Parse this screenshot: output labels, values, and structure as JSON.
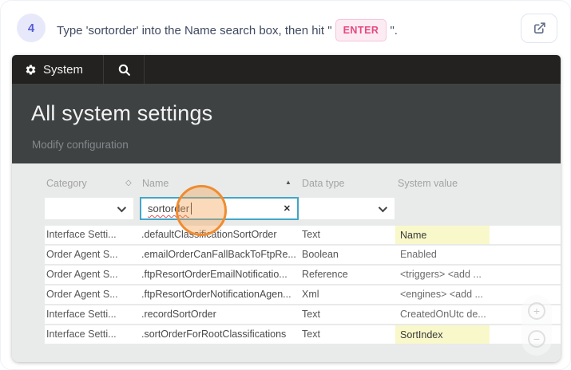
{
  "step": {
    "number": "4",
    "instruction_prefix": "Type 'sortorder' into the Name search box, then hit \"",
    "key_label": "ENTER",
    "instruction_suffix": "\"."
  },
  "app": {
    "navbar": {
      "system_label": "System"
    },
    "header": {
      "title": "All system settings",
      "subtitle": "Modify configuration"
    },
    "table": {
      "headers": {
        "category": "Category",
        "name": "Name",
        "data_type": "Data type",
        "system_value": "System value"
      },
      "filters": {
        "name_value": "sortorder"
      },
      "rows": [
        {
          "category": "Interface Setti...",
          "name": ".defaultClassificationSortOrder",
          "data_type": "Text",
          "system_value": "Name"
        },
        {
          "category": "Order Agent S...",
          "name": ".emailOrderCanFallBackToFtpRe...",
          "data_type": "Boolean",
          "system_value": "Enabled"
        },
        {
          "category": "Order Agent S...",
          "name": ".ftpResortOrderEmailNotificatio...",
          "data_type": "Reference",
          "system_value": "<triggers> <add ..."
        },
        {
          "category": "Order Agent S...",
          "name": ".ftpResortOrderNotificationAgen...",
          "data_type": "Xml",
          "system_value": "<engines> <add ..."
        },
        {
          "category": "Interface Setti...",
          "name": ".recordSortOrder",
          "data_type": "Text",
          "system_value": "CreatedOnUtc de..."
        },
        {
          "category": "Interface Setti...",
          "name": ".sortOrderForRootClassifications",
          "data_type": "Text",
          "system_value": "SortIndex"
        }
      ]
    }
  },
  "colors": {
    "accent_orange": "#ee8c32",
    "highlight_yellow": "#f8f8cb",
    "focus_border": "#40a7c9",
    "key_badge_pink": "#e4487f",
    "step_indigo": "#575dd3"
  }
}
